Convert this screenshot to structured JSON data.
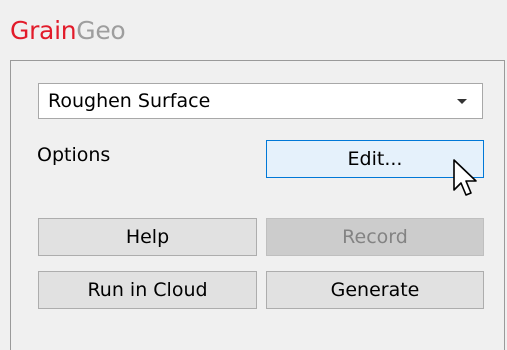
{
  "header": {
    "title_part1": "Grain",
    "title_part2": "Geo",
    "colors": {
      "part1": "#e21b2a",
      "part2": "#9e9e9e"
    }
  },
  "operation_select": {
    "value": "Roughen Surface"
  },
  "options": {
    "label": "Options",
    "edit_button": "Edit..."
  },
  "buttons": {
    "help": "Help",
    "record": "Record",
    "run_in_cloud": "Run in Cloud",
    "generate": "Generate"
  },
  "icons": {
    "dropdown": "chevron-down-icon",
    "cursor": "mouse-pointer-icon"
  }
}
